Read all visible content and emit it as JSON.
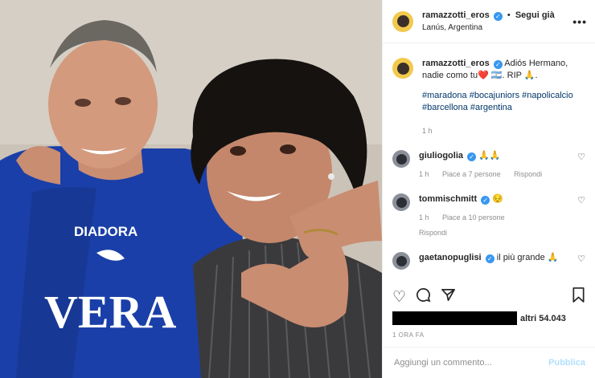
{
  "post": {
    "username": "ramazzotti_eros",
    "follow_label": "Segui già",
    "location": "Lanús, Argentina",
    "more_label": "•••",
    "caption_username": "ramazzotti_eros",
    "caption_text": "Adiós Hermano, nadie como tu❤️ 🇦🇷. RIP 🙏.",
    "hashtags": "#maradona #bocajuniors #napolicalcio #barcellona #argentina",
    "caption_time": "1 h",
    "shirt_brand_top": "DIADORA",
    "shirt_brand_main": "VERA"
  },
  "comments": [
    {
      "username": "giuliogolia",
      "text": "🙏🙏",
      "time": "1 h",
      "likes": "Piace a 7 persone",
      "reply": "Rispondi"
    },
    {
      "username": "tommischmitt",
      "text": "😔",
      "time": "1 h",
      "likes": "Piace a 10 persone",
      "reply": "Rispondi"
    },
    {
      "username": "gaetanopuglisi",
      "text": "il più grande 🙏",
      "time": "",
      "likes": "",
      "reply": ""
    }
  ],
  "actions": {
    "like_icon": "heart-icon",
    "comment_icon": "comment-icon",
    "share_icon": "share-icon",
    "save_icon": "bookmark-icon",
    "likes_text": "altri 54.043",
    "timestamp": "1 ORA FA"
  },
  "composer": {
    "placeholder": "Aggiungi un commento...",
    "publish_label": "Pubblica"
  },
  "colors": {
    "link": "#00376b",
    "verified": "#3897f0",
    "publish_disabled": "#b2dffc",
    "shirt_blue": "#1a3fa8"
  }
}
